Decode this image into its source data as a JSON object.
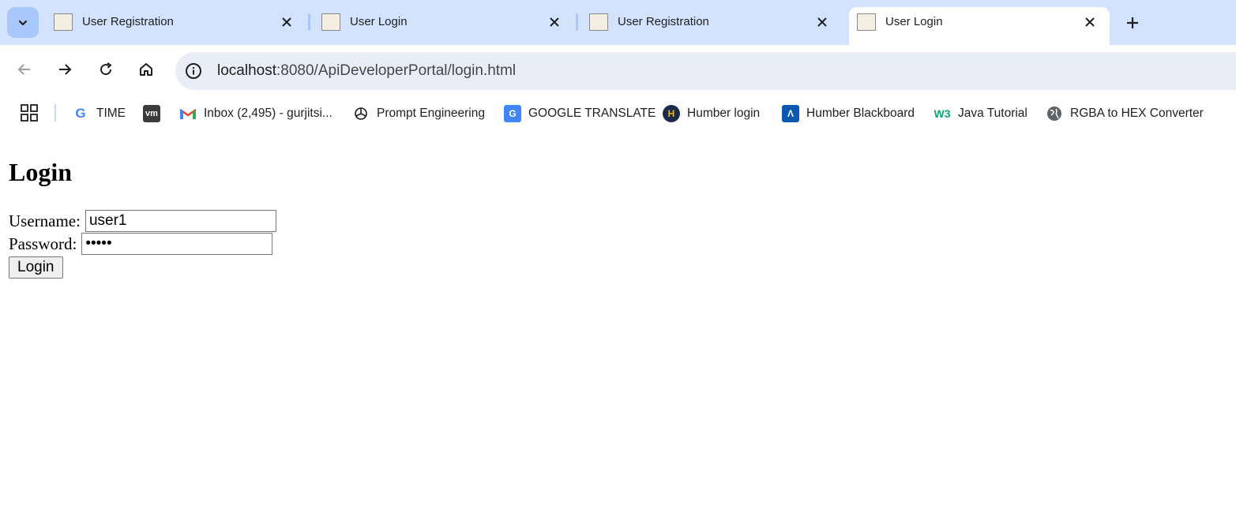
{
  "browser": {
    "tabs": [
      {
        "title": "User Registration",
        "active": false
      },
      {
        "title": "User Login",
        "active": false
      },
      {
        "title": "User Registration",
        "active": false
      },
      {
        "title": "User Login",
        "active": true
      }
    ],
    "address": {
      "host": "localhost",
      "path": ":8080/ApiDeveloperPortal/login.html"
    },
    "bookmarks": [
      {
        "label": "TIME",
        "icon": "google-icon"
      },
      {
        "label": "",
        "icon": "vm-icon",
        "icon_text": "vm"
      },
      {
        "label": "Inbox (2,495) - gurjitsi...",
        "icon": "gmail-icon"
      },
      {
        "label": "Prompt Engineering",
        "icon": "openai-icon"
      },
      {
        "label": "GOOGLE TRANSLATE",
        "icon": "google-translate-icon"
      },
      {
        "label": "Humber login",
        "icon": "humber-icon"
      },
      {
        "label": "Humber Blackboard",
        "icon": "blackboard-icon"
      },
      {
        "label": "Java Tutorial",
        "icon": "w3schools-icon",
        "icon_text": "W3"
      },
      {
        "label": "RGBA to HEX Converter",
        "icon": "globe-icon"
      }
    ]
  },
  "page": {
    "heading": "Login",
    "username_label": "Username:",
    "username_value": "user1",
    "password_label": "Password:",
    "password_value": "12345",
    "login_button": "Login"
  },
  "colors": {
    "tabstrip": "#d3e3fd",
    "omnibox": "#e9eef6",
    "accent": "#a8c7fa"
  }
}
